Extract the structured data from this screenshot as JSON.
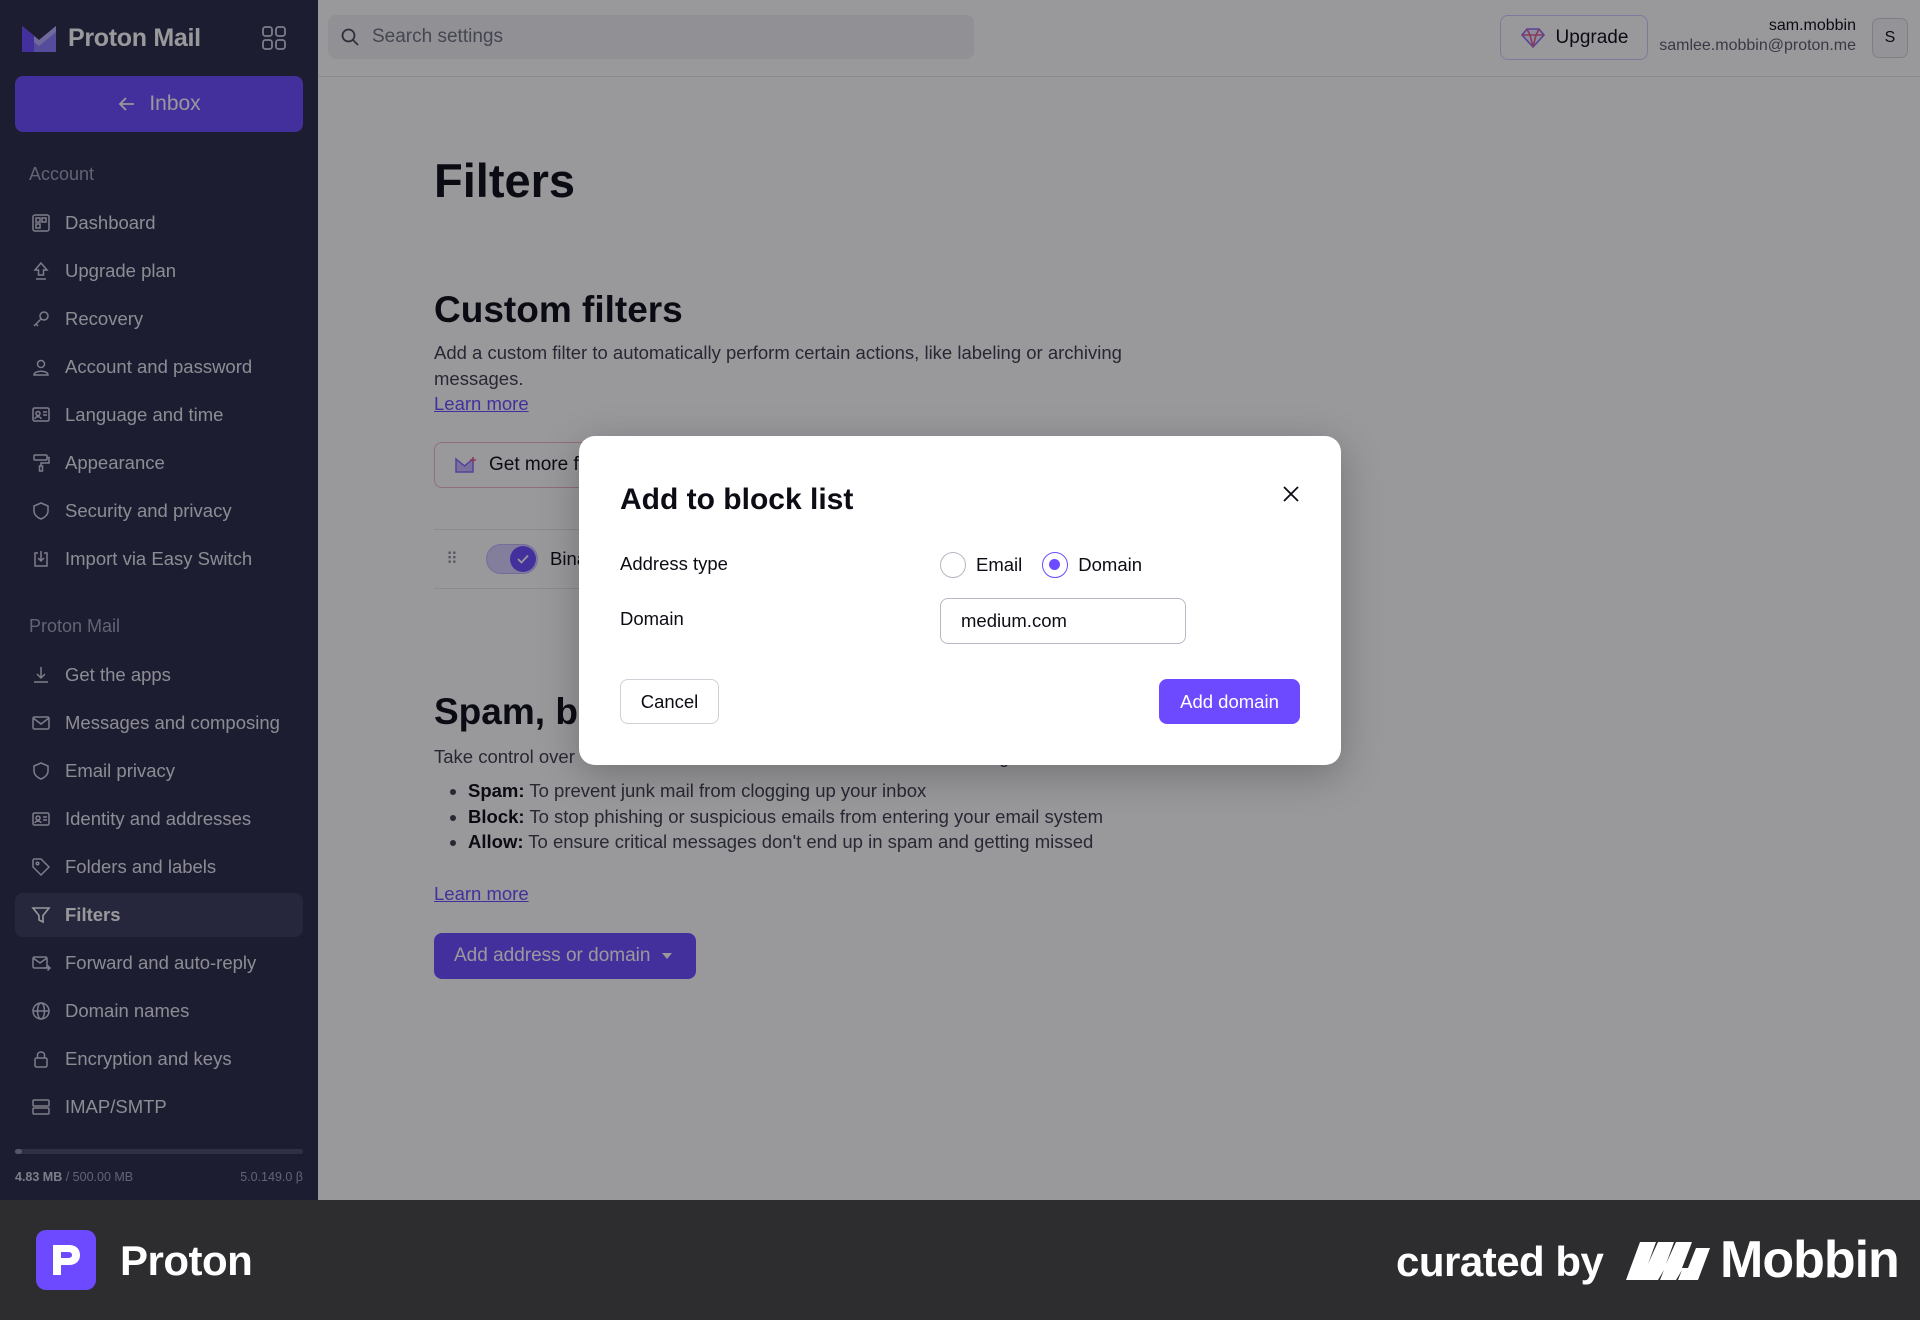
{
  "brand": {
    "name": "Proton Mail",
    "accent": "#6d4aff",
    "sidebar_bg": "#292a48"
  },
  "sidebar": {
    "inbox_label": "Inbox",
    "sections": {
      "account": "Account",
      "mail": "Proton Mail"
    },
    "account_items": [
      {
        "label": "Dashboard",
        "icon": "dashboard-icon"
      },
      {
        "label": "Upgrade plan",
        "icon": "upgrade-icon"
      },
      {
        "label": "Recovery",
        "icon": "key-icon"
      },
      {
        "label": "Account and password",
        "icon": "user-icon"
      },
      {
        "label": "Language and time",
        "icon": "language-icon"
      },
      {
        "label": "Appearance",
        "icon": "paint-roller-icon"
      },
      {
        "label": "Security and privacy",
        "icon": "shield-icon"
      },
      {
        "label": "Import via Easy Switch",
        "icon": "import-icon"
      }
    ],
    "mail_items": [
      {
        "label": "Get the apps",
        "icon": "download-icon"
      },
      {
        "label": "Messages and composing",
        "icon": "envelope-icon"
      },
      {
        "label": "Email privacy",
        "icon": "shield-icon"
      },
      {
        "label": "Identity and addresses",
        "icon": "id-card-icon"
      },
      {
        "label": "Folders and labels",
        "icon": "tag-icon"
      },
      {
        "label": "Filters",
        "icon": "filter-icon",
        "active": true
      },
      {
        "label": "Forward and auto-reply",
        "icon": "forward-icon"
      },
      {
        "label": "Domain names",
        "icon": "globe-icon"
      },
      {
        "label": "Encryption and keys",
        "icon": "lock-icon"
      },
      {
        "label": "IMAP/SMTP",
        "icon": "server-icon"
      }
    ],
    "storage": {
      "used": "4.83 MB",
      "total": "500.00 MB",
      "separator": " / ",
      "fraction": 0.0097
    },
    "version": "5.0.149.0 β"
  },
  "header": {
    "search_placeholder": "Search settings",
    "upgrade_label": "Upgrade",
    "user_name": "sam.mobbin",
    "user_email": "samlee.mobbin@proton.me",
    "avatar_initial": "S"
  },
  "main": {
    "title": "Filters",
    "custom": {
      "heading": "Custom filters",
      "description_line1": "Add a custom filter to automatically perform certain actions, like labeling or archiving",
      "description_line2": "messages.",
      "learn_more": "Learn more",
      "get_more_label": "Get more f",
      "filter_name": "Bina"
    },
    "spam": {
      "heading": "Spam, bl",
      "description": "Take control over",
      "description_tail": "g",
      "bullets": [
        {
          "term": "Spam:",
          "text": " To prevent junk mail from clogging up your inbox"
        },
        {
          "term": "Block:",
          "text": " To stop phishing or suspicious emails from entering your email system"
        },
        {
          "term": "Allow:",
          "text": " To ensure critical messages don't end up in spam and getting missed"
        }
      ],
      "learn_more": "Learn more",
      "add_button": "Add address or domain"
    }
  },
  "modal": {
    "title": "Add to block list",
    "address_type_label": "Address type",
    "options": {
      "email": "Email",
      "domain": "Domain"
    },
    "selected": "domain",
    "domain_label": "Domain",
    "domain_value": "medium.com",
    "cancel": "Cancel",
    "submit": "Add domain"
  },
  "footer": {
    "app_name": "Proton",
    "curated_by": "curated by",
    "curator": "Mobbin"
  }
}
